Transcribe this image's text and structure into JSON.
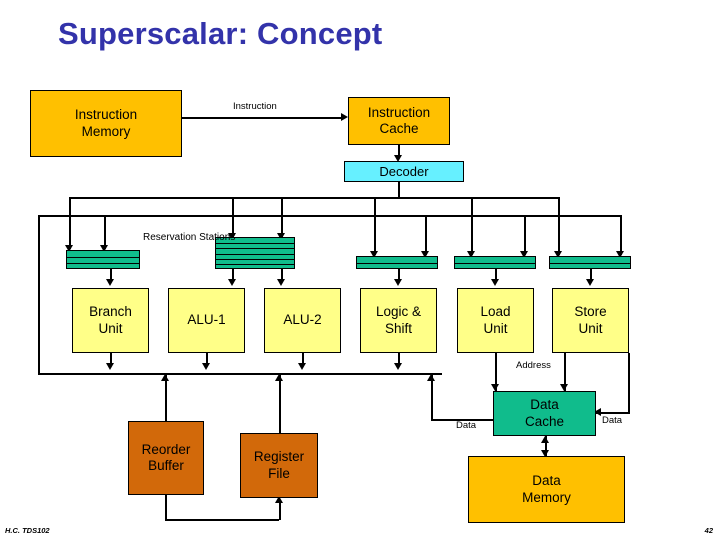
{
  "slide": {
    "title": "Superscalar: Concept",
    "footer_left": "H.C. TDS102",
    "page_number": "42"
  },
  "blocks": {
    "instruction_memory": {
      "line1": "Instruction",
      "line2": "Memory",
      "color": "#ffc000"
    },
    "instruction_cache": {
      "line1": "Instruction",
      "line2": "Cache",
      "color": "#ffc000"
    },
    "decoder": {
      "label": "Decoder",
      "color": "#66f0ff"
    },
    "branch_unit": {
      "line1": "Branch",
      "line2": "Unit",
      "color": "#ffff88"
    },
    "alu1": {
      "label": "ALU-1",
      "color": "#ffff88"
    },
    "alu2": {
      "label": "ALU-2",
      "color": "#ffff88"
    },
    "logic_shift": {
      "line1": "Logic &",
      "line2": "Shift",
      "color": "#ffff88"
    },
    "load_unit": {
      "line1": "Load",
      "line2": "Unit",
      "color": "#ffff88"
    },
    "store_unit": {
      "line1": "Store",
      "line2": "Unit",
      "color": "#ffff88"
    },
    "reorder_buffer": {
      "line1": "Reorder",
      "line2": "Buffer",
      "color": "#d2690a"
    },
    "register_file": {
      "line1": "Register",
      "line2": "File",
      "color": "#d2690a"
    },
    "data_cache": {
      "line1": "Data",
      "line2": "Cache",
      "color": "#10bc8c"
    },
    "data_memory": {
      "line1": "Data",
      "line2": "Memory",
      "color": "#ffc000"
    }
  },
  "reservation_stations": {
    "caption_line1": "Reservation",
    "caption_line2": "Stations",
    "color": "#10bc8c",
    "units": [
      {
        "unit": "branch-unit",
        "slots": 3
      },
      {
        "unit": "alu",
        "slots": 6
      },
      {
        "unit": "logic-shift",
        "slots": 2
      },
      {
        "unit": "load-unit",
        "slots": 2
      },
      {
        "unit": "store-unit",
        "slots": 2
      }
    ]
  },
  "edge_labels": {
    "instruction": "Instruction",
    "address": "Address",
    "data_left": "Data",
    "data_right": "Data"
  }
}
